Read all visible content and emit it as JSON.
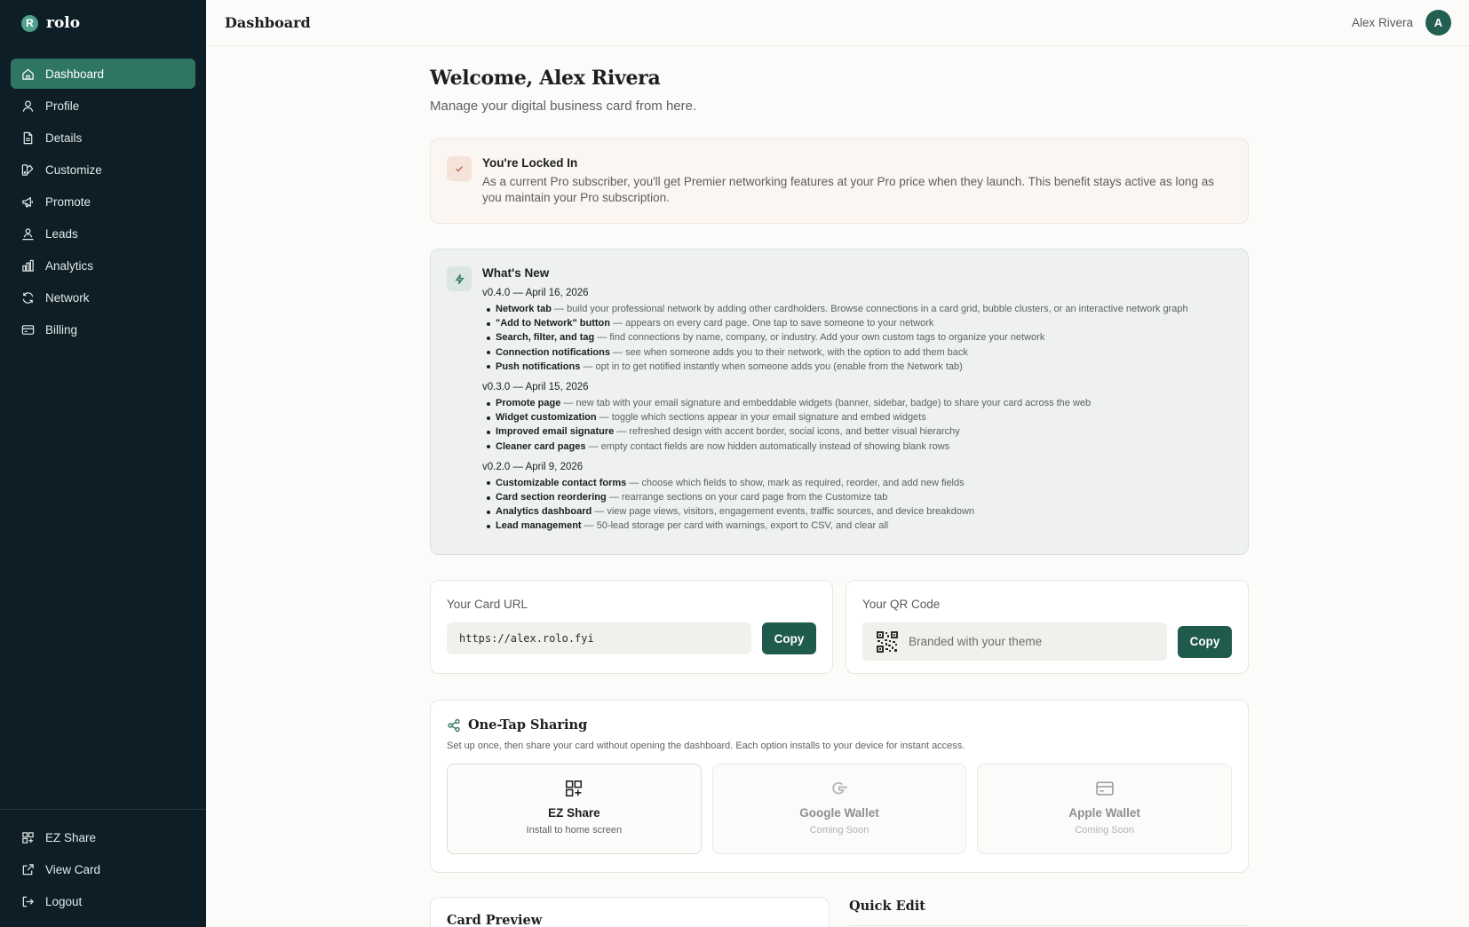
{
  "brand": {
    "logo_letter": "R",
    "name": "rolo"
  },
  "sidebar": {
    "items": [
      {
        "label": "Dashboard",
        "icon": "home-icon",
        "active": true
      },
      {
        "label": "Profile",
        "icon": "user-icon"
      },
      {
        "label": "Details",
        "icon": "document-icon"
      },
      {
        "label": "Customize",
        "icon": "palette-icon"
      },
      {
        "label": "Promote",
        "icon": "megaphone-icon"
      },
      {
        "label": "Leads",
        "icon": "leads-icon"
      },
      {
        "label": "Analytics",
        "icon": "bar-chart-icon"
      },
      {
        "label": "Network",
        "icon": "refresh-icon"
      },
      {
        "label": "Billing",
        "icon": "credit-card-icon"
      }
    ],
    "bottom_items": [
      {
        "label": "EZ Share",
        "icon": "grid-plus-icon"
      },
      {
        "label": "View Card",
        "icon": "external-link-icon"
      },
      {
        "label": "Logout",
        "icon": "logout-icon"
      }
    ]
  },
  "header": {
    "title": "Dashboard",
    "user_name": "Alex Rivera",
    "avatar_letter": "A"
  },
  "main": {
    "welcome": "Welcome, Alex Rivera",
    "subtitle": "Manage your digital business card from here.",
    "locked": {
      "title": "You're Locked In",
      "text": "As a current Pro subscriber, you'll get Premier networking features at your Pro price when they launch. This benefit stays active as long as you maintain your Pro subscription."
    },
    "whats_new": {
      "title": "What's New",
      "releases": [
        {
          "version": "v0.4.0 — April 16, 2026",
          "items": [
            {
              "bold": "Network tab",
              "text": " — build your professional network by adding other cardholders. Browse connections in a card grid, bubble clusters, or an interactive network graph"
            },
            {
              "bold": "\"Add to Network\" button",
              "text": " — appears on every card page. One tap to save someone to your network"
            },
            {
              "bold": "Search, filter, and tag",
              "text": " — find connections by name, company, or industry. Add your own custom tags to organize your network"
            },
            {
              "bold": "Connection notifications",
              "text": " — see when someone adds you to their network, with the option to add them back"
            },
            {
              "bold": "Push notifications",
              "text": " — opt in to get notified instantly when someone adds you (enable from the Network tab)"
            }
          ]
        },
        {
          "version": "v0.3.0 — April 15, 2026",
          "items": [
            {
              "bold": "Promote page",
              "text": " — new tab with your email signature and embeddable widgets (banner, sidebar, badge) to share your card across the web"
            },
            {
              "bold": "Widget customization",
              "text": " — toggle which sections appear in your email signature and embed widgets"
            },
            {
              "bold": "Improved email signature",
              "text": " — refreshed design with accent border, social icons, and better visual hierarchy"
            },
            {
              "bold": "Cleaner card pages",
              "text": " — empty contact fields are now hidden automatically instead of showing blank rows"
            }
          ]
        },
        {
          "version": "v0.2.0 — April 9, 2026",
          "items": [
            {
              "bold": "Customizable contact forms",
              "text": " — choose which fields to show, mark as required, reorder, and add new fields"
            },
            {
              "bold": "Card section reordering",
              "text": " — rearrange sections on your card page from the Customize tab"
            },
            {
              "bold": "Analytics dashboard",
              "text": " — view page views, visitors, engagement events, traffic sources, and device breakdown"
            },
            {
              "bold": "Lead management",
              "text": " — 50-lead storage per card with warnings, export to CSV, and clear all"
            }
          ]
        }
      ]
    },
    "card_url": {
      "label": "Your Card URL",
      "value": "https://alex.rolo.fyi",
      "copy_label": "Copy"
    },
    "qr_code": {
      "label": "Your QR Code",
      "placeholder": "Branded with your theme",
      "copy_label": "Copy"
    },
    "sharing": {
      "title": "One-Tap Sharing",
      "description": "Set up once, then share your card without opening the dashboard. Each option installs to your device for instant access.",
      "options": [
        {
          "name": "EZ Share",
          "sub": "Install to home screen",
          "icon": "grid-plus-icon",
          "enabled": true
        },
        {
          "name": "Google Wallet",
          "sub": "Coming Soon",
          "icon": "google-icon",
          "enabled": false
        },
        {
          "name": "Apple Wallet",
          "sub": "Coming Soon",
          "icon": "wallet-card-icon",
          "enabled": false
        }
      ]
    },
    "card_preview_title": "Card Preview",
    "quick_edit_title": "Quick Edit"
  },
  "colors": {
    "sidebar_bg": "#0d1e26",
    "accent": "#2e7563",
    "button": "#1f5b4d",
    "locked_bg": "#fbf6f2",
    "whats_new_bg": "#eef1ef"
  }
}
